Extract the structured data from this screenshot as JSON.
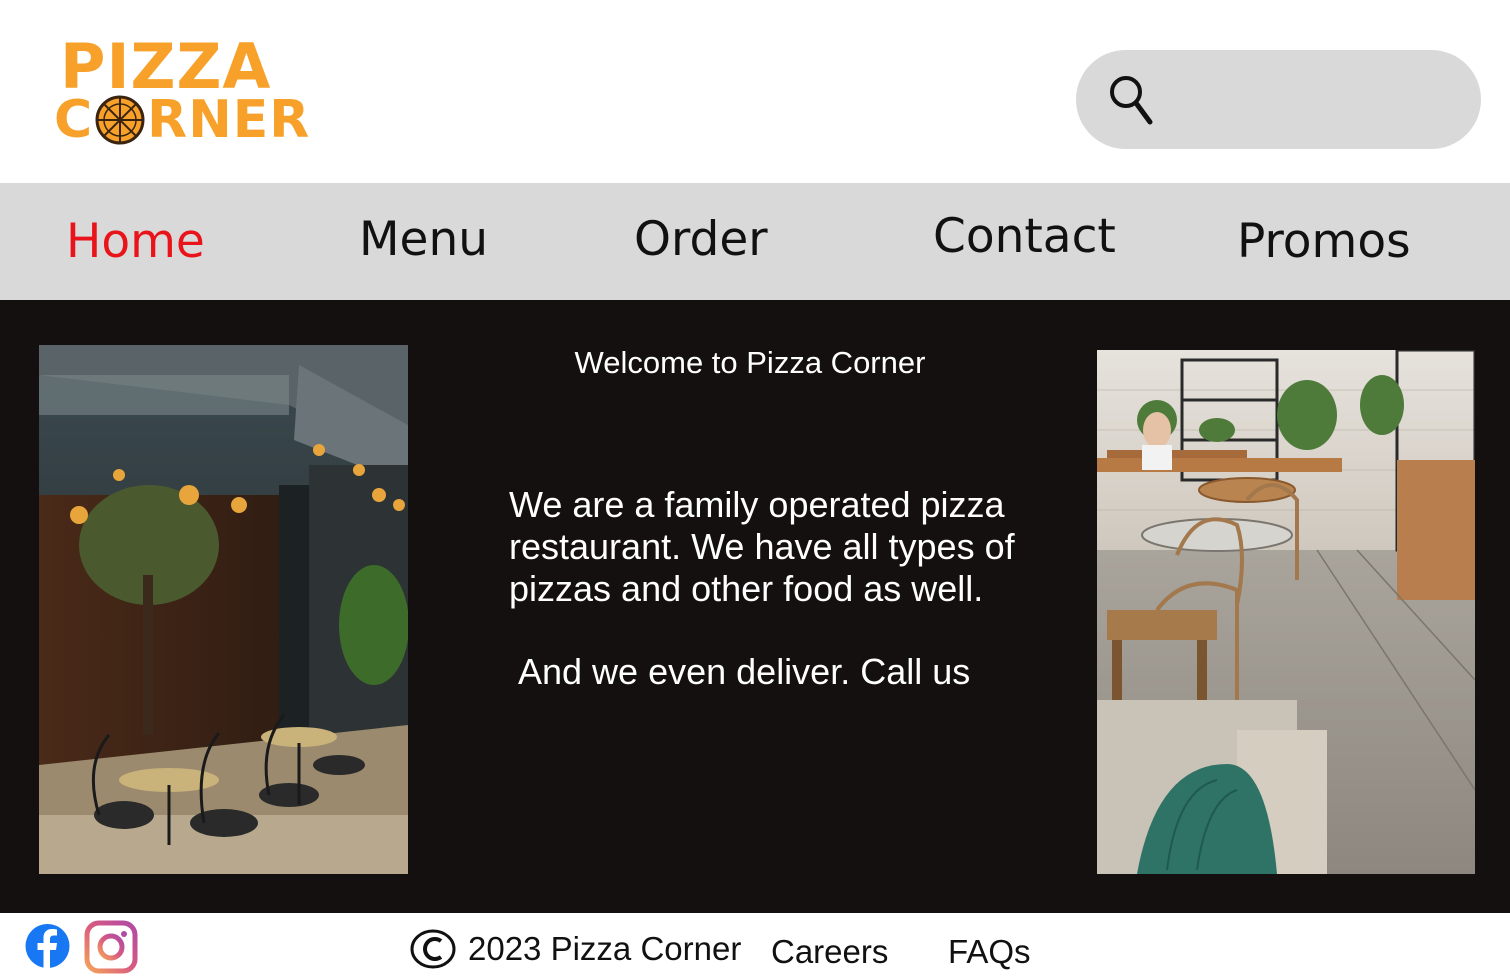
{
  "brand": {
    "logo_line1": "PIZZA",
    "logo_line2_start": "C",
    "logo_line2_end": "RNER",
    "color": "#F7A12B"
  },
  "search": {
    "icon": "search-icon",
    "placeholder": ""
  },
  "nav": {
    "items": [
      {
        "label": "Home",
        "active": true
      },
      {
        "label": "Menu",
        "active": false
      },
      {
        "label": "Order",
        "active": false
      },
      {
        "label": "Contact",
        "active": false
      },
      {
        "label": "Promos",
        "active": false
      }
    ],
    "active_color": "#E8141A"
  },
  "main": {
    "welcome": "Welcome to Pizza Corner",
    "about": "We are a family operated pizza restaurant.  We have all types of pizzas and other food as well.",
    "deliver": "And we even deliver. Call us"
  },
  "footer": {
    "copyright": "2023 Pizza Corner",
    "careers": "Careers",
    "faqs": "FAQs",
    "social_icons": [
      "facebook-icon",
      "instagram-icon"
    ]
  },
  "colors": {
    "nav_bg": "#D9D9D9",
    "main_bg": "#141010",
    "search_bg": "#D9D9D9"
  }
}
